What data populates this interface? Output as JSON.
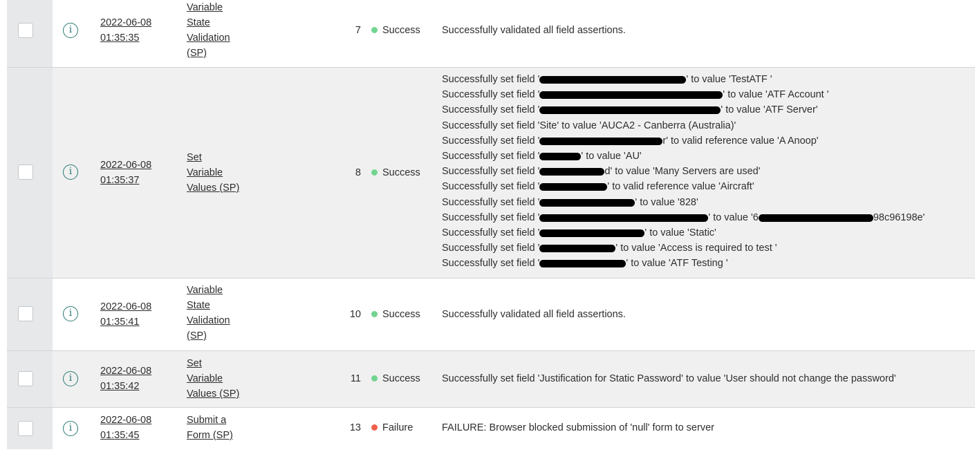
{
  "rows": [
    {
      "date": "2022-06-08",
      "time": "01:35:35",
      "step_lines": [
        "Variable",
        "State",
        "Validation",
        "(SP)"
      ],
      "order": "7",
      "status": "Success",
      "status_color": "#71d58f",
      "messages": [
        "Successfully validated all field assertions."
      ]
    },
    {
      "date": "2022-06-08",
      "time": "01:35:37",
      "step_lines": [
        "Set",
        "Variable",
        "Values (SP)"
      ],
      "order": "8",
      "status": "Success",
      "status_color": "#71d58f",
      "message_lines": [
        {
          "pre": "Successfully set field '",
          "post": "' to value 'TestATF '"
        },
        {
          "pre": "Successfully set field '",
          "post": "' to value 'ATF Account '"
        },
        {
          "pre": "Successfully set field '",
          "post": "' to value 'ATF Server'"
        },
        {
          "pre": "Successfully set field 'Site' to value 'AUCA2 - Canberra (Australia)'",
          "post": ""
        },
        {
          "pre": "Successfully set field '",
          "post": "r' to valid reference value 'A Anoop'"
        },
        {
          "pre": "Successfully set field '",
          "post": "' to value 'AU'"
        },
        {
          "pre": "Successfully set field '",
          "post": "d' to value 'Many Servers are used'"
        },
        {
          "pre": "Successfully set field '",
          "post": "' to valid reference value 'Aircraft'"
        },
        {
          "pre": "Successfully set field '",
          "post": "' to value '828'"
        },
        {
          "pre": "Successfully set field '",
          "mid": "' to value '6",
          "post": "98c96198e'"
        },
        {
          "pre": "Successfully set field '",
          "post": "' to value 'Static'"
        },
        {
          "pre": "Successfully set field '",
          "post": "' to value 'Access is required to test '"
        },
        {
          "pre": "Successfully set field '",
          "post": "' to value 'ATF Testing '"
        }
      ]
    },
    {
      "date": "2022-06-08",
      "time": "01:35:41",
      "step_lines": [
        "Variable",
        "State",
        "Validation",
        "(SP)"
      ],
      "order": "10",
      "status": "Success",
      "status_color": "#71d58f",
      "messages": [
        "Successfully validated all field assertions."
      ]
    },
    {
      "date": "2022-06-08",
      "time": "01:35:42",
      "step_lines": [
        "Set",
        "Variable",
        "Values (SP)"
      ],
      "order": "11",
      "status": "Success",
      "status_color": "#71d58f",
      "messages": [
        "Successfully set field 'Justification for Static Password' to value 'User should not change the password'"
      ]
    },
    {
      "date": "2022-06-08",
      "time": "01:35:45",
      "step_lines": [
        "Submit a",
        "Form (SP)"
      ],
      "order": "13",
      "status": "Failure",
      "status_color": "#f0604a",
      "messages": [
        "FAILURE: Browser blocked submission of 'null' form to server"
      ]
    }
  ],
  "icons": {
    "checkbox": "checkbox-icon",
    "info": "info-circle-icon",
    "status": "status-dot-icon"
  }
}
